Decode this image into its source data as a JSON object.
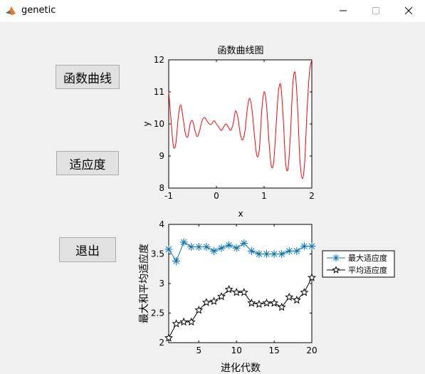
{
  "window": {
    "title": "genetic",
    "icon": "matlab-icon",
    "controls": [
      "minimize-icon",
      "maximize-icon",
      "close-icon"
    ]
  },
  "buttons": {
    "function_curve": "函数曲线",
    "fitness": "适应度",
    "exit": "退出"
  },
  "chart_data": [
    {
      "type": "line",
      "title": "函数曲线图",
      "xlabel": "x",
      "ylabel": "y",
      "xlim": [
        -1,
        2
      ],
      "ylim": [
        8,
        12
      ],
      "xticks": [
        "-1",
        "0",
        "1",
        "2"
      ],
      "yticks": [
        "8",
        "9",
        "10",
        "11",
        "12"
      ],
      "grid": false,
      "series": [
        {
          "color": "#ff0000",
          "x": [
            -1.0,
            -0.95,
            -0.9,
            -0.85,
            -0.8,
            -0.75,
            -0.7,
            -0.65,
            -0.6,
            -0.55,
            -0.5,
            -0.45,
            -0.4,
            -0.35,
            -0.3,
            -0.25,
            -0.2,
            -0.15,
            -0.1,
            -0.05,
            0.0,
            0.05,
            0.1,
            0.15,
            0.2,
            0.25,
            0.3,
            0.35,
            0.4,
            0.45,
            0.5,
            0.55,
            0.6,
            0.65,
            0.7,
            0.75,
            0.8,
            0.85,
            0.9,
            0.95,
            1.0,
            1.05,
            1.1,
            1.15,
            1.2,
            1.25,
            1.3,
            1.35,
            1.4,
            1.45,
            1.5,
            1.55,
            1.6,
            1.65,
            1.7,
            1.75,
            1.8,
            1.85,
            1.9,
            1.95,
            2.0
          ],
          "y": [
            11.0,
            10.1,
            9.3,
            9.4,
            10.2,
            10.6,
            10.2,
            9.7,
            9.6,
            10.0,
            10.1,
            9.8,
            9.6,
            9.8,
            10.1,
            10.2,
            10.1,
            10.0,
            10.0,
            10.1,
            10.0,
            9.9,
            9.8,
            9.9,
            10.0,
            9.9,
            9.8,
            10.0,
            10.4,
            10.2,
            9.7,
            9.5,
            9.8,
            10.5,
            10.8,
            10.4,
            9.6,
            9.0,
            9.2,
            10.4,
            11.0,
            10.6,
            9.5,
            8.7,
            8.8,
            9.9,
            11.0,
            11.2,
            10.2,
            8.8,
            8.6,
            9.6,
            11.2,
            11.6,
            10.6,
            8.9,
            8.3,
            8.8,
            10.4,
            11.6,
            12.0
          ]
        }
      ]
    },
    {
      "type": "line",
      "title": "",
      "xlabel": "进化代数",
      "ylabel": "最大和平均适应度",
      "xlim": [
        1,
        20
      ],
      "ylim": [
        2,
        4
      ],
      "xticks": [
        "5",
        "10",
        "15",
        "20"
      ],
      "yticks": [
        "2",
        "2.5",
        "3",
        "3.5",
        "4"
      ],
      "grid": false,
      "legend_position": "right",
      "series": [
        {
          "name": "最大适应度",
          "color": "#0072bd",
          "marker": "asterisk",
          "x": [
            1,
            2,
            3,
            4,
            5,
            6,
            7,
            8,
            9,
            10,
            11,
            12,
            13,
            14,
            15,
            16,
            17,
            18,
            19,
            20
          ],
          "y": [
            3.58,
            3.38,
            3.7,
            3.62,
            3.62,
            3.62,
            3.55,
            3.6,
            3.65,
            3.6,
            3.68,
            3.55,
            3.5,
            3.5,
            3.5,
            3.5,
            3.55,
            3.55,
            3.63,
            3.63
          ]
        },
        {
          "name": "平均适应度",
          "color": "#000000",
          "marker": "pentagram",
          "x": [
            1,
            2,
            3,
            4,
            5,
            6,
            7,
            8,
            9,
            10,
            11,
            12,
            13,
            14,
            15,
            16,
            17,
            18,
            19,
            20
          ],
          "y": [
            2.08,
            2.32,
            2.35,
            2.35,
            2.55,
            2.68,
            2.7,
            2.78,
            2.9,
            2.85,
            2.85,
            2.67,
            2.65,
            2.67,
            2.67,
            2.6,
            2.77,
            2.72,
            2.85,
            3.1
          ]
        }
      ]
    }
  ]
}
